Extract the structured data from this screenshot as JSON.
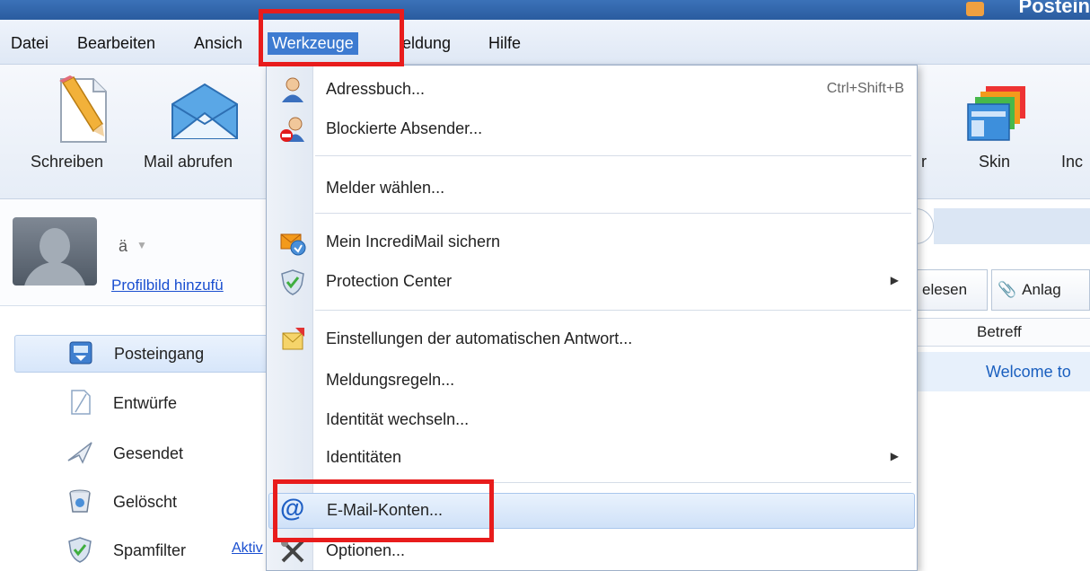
{
  "title_bar": {
    "text": "Postein"
  },
  "menu": {
    "items": [
      {
        "label": "Datei",
        "key": "D"
      },
      {
        "label": "Bearbeiten",
        "key": "B"
      },
      {
        "label": "Ansicht",
        "key": "A"
      },
      {
        "label": "Werkzeuge",
        "key": "W"
      },
      {
        "label": "Meldung",
        "key": "M"
      },
      {
        "label": "Hilfe",
        "key": "H"
      }
    ],
    "datei": "Datei",
    "bearbeiten": "Bearbeiten",
    "ansicht": "Ansich",
    "werkzeuge": "Werkzeuge",
    "meldung": "eldung",
    "hilfe": "Hilfe"
  },
  "toolbar": {
    "schreiben": "Schreiben",
    "mail_abrufen": "Mail abrufen",
    "partial_r": "r",
    "skin": "Skin",
    "partial_in": "Inc"
  },
  "profile": {
    "name": "ä",
    "add_photo_link": "Profilbild hinzufü"
  },
  "folders": [
    {
      "label": "Posteingang",
      "icon": "inbox-icon",
      "selected": true
    },
    {
      "label": "Entwürfe",
      "icon": "drafts-icon"
    },
    {
      "label": "Gesendet",
      "icon": "sent-icon"
    },
    {
      "label": "Gelöscht",
      "icon": "trash-icon"
    },
    {
      "label": "Spamfilter",
      "icon": "shield-icon"
    }
  ],
  "spam_link": "Aktiv",
  "filter_tabs": {
    "gelesen": "elesen",
    "anlagen": "Anlag"
  },
  "message_list": {
    "column_betreff": "Betreff",
    "rows": [
      {
        "subject": "Welcome to"
      }
    ]
  },
  "dropdown": {
    "items": [
      {
        "label": "Adressbuch...",
        "shortcut": "Ctrl+Shift+B",
        "icon": "address-book-icon"
      },
      {
        "label": "Blockierte Absender...",
        "icon": "blocked-sender-icon"
      },
      {
        "label": "Melder wählen...",
        "icon": ""
      },
      {
        "label": "Mein IncrediMail sichern",
        "icon": "backup-icon"
      },
      {
        "label": "Protection Center",
        "icon": "protection-shield-icon",
        "submenu": true
      },
      {
        "label": "Einstellungen der automatischen Antwort...",
        "icon": "auto-reply-icon"
      },
      {
        "label": "Meldungsregeln...",
        "icon": ""
      },
      {
        "label": "Identität wechseln...",
        "icon": ""
      },
      {
        "label": "Identitäten",
        "icon": "",
        "submenu": true
      },
      {
        "label": "E-Mail-Konten...",
        "icon": "at-sign-icon",
        "highlighted": true
      },
      {
        "label": "Optionen...",
        "icon": "tools-icon"
      }
    ],
    "adressbuch": "Adressbuch...",
    "adressbuch_shortcut": "Ctrl+Shift+B",
    "blockierte": "Blockierte Absender...",
    "melder": "Melder wählen...",
    "sichern": "Mein IncrediMail sichern",
    "protection": "Protection Center",
    "autoantwort": "Einstellungen der automatischen Antwort...",
    "regeln": "Meldungsregeln...",
    "identitaet_wechseln": "Identität wechseln...",
    "identitaeten": "Identitäten",
    "email_konten": "E-Mail-Konten...",
    "optionen": "Optionen..."
  },
  "colors": {
    "highlight_red": "#e81c1c",
    "menu_active": "#3d7bd1",
    "link_blue": "#1a4fd0"
  }
}
